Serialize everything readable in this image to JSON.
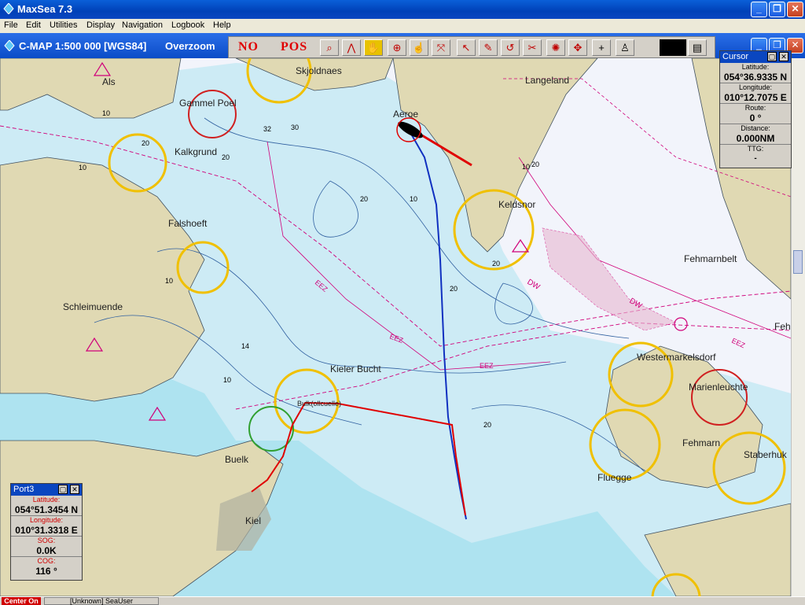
{
  "app": {
    "title": "MaxSea 7.3"
  },
  "menu": [
    "File",
    "Edit",
    "Utilities",
    "Display",
    "Navigation",
    "Logbook",
    "Help"
  ],
  "chart": {
    "title": "C-MAP  1:500 000 [WGS84]",
    "overzoom": "Overzoom"
  },
  "toolbar": {
    "no_label": "NO",
    "pos_label": "POS"
  },
  "place_labels": [
    "Als",
    "Skjoldnaes",
    "Langeland",
    "Gammel Poel",
    "Aeroe",
    "Kalkgrund",
    "Keldsnor",
    "Falshoeft",
    "Fehmarnbelt",
    "Schleimuende",
    "Fehm",
    "Kieler Bucht",
    "Westermarkelsdorf",
    "Marienleuchte",
    "Buelk",
    "Fehmarn",
    "Staberhuk",
    "Fluegge",
    "Kiel",
    "Bulk(ollcuelle)"
  ],
  "zone_labels": [
    "EEZ",
    "DW"
  ],
  "depth_labels": [
    "10",
    "20",
    "30",
    "32",
    "14",
    "20",
    "10",
    "10",
    "20",
    "20",
    "10",
    "20",
    "10",
    "10",
    "20",
    "20"
  ],
  "cursor_panel": {
    "title": "Cursor",
    "latitude_label": "Latitude:",
    "latitude": "054°36.9335 N",
    "longitude_label": "Longitude:",
    "longitude": "010°12.7075 E",
    "route_label": "Route:",
    "route": "0 °",
    "distance_label": "Distance:",
    "distance": "0.000NM",
    "ttg_label": "TTG:",
    "ttg": "-"
  },
  "port_panel": {
    "title": "Port3",
    "latitude_label": "Latitude:",
    "latitude": "054°51.3454 N",
    "longitude_label": "Longitude:",
    "longitude": "010°31.3318 E",
    "sog_label": "SOG:",
    "sog": "0.0K",
    "cog_label": "COG:",
    "cog": "116 °"
  },
  "status": {
    "center_label": "Center On",
    "user_label": "[Unknown] SeaUser"
  },
  "colors": {
    "water": "#f2f4fb",
    "shallow": "#aee3f0",
    "land": "#e0d9b3",
    "track": "#1030c0",
    "route": "#e00000",
    "accent": "#0a46c0"
  }
}
